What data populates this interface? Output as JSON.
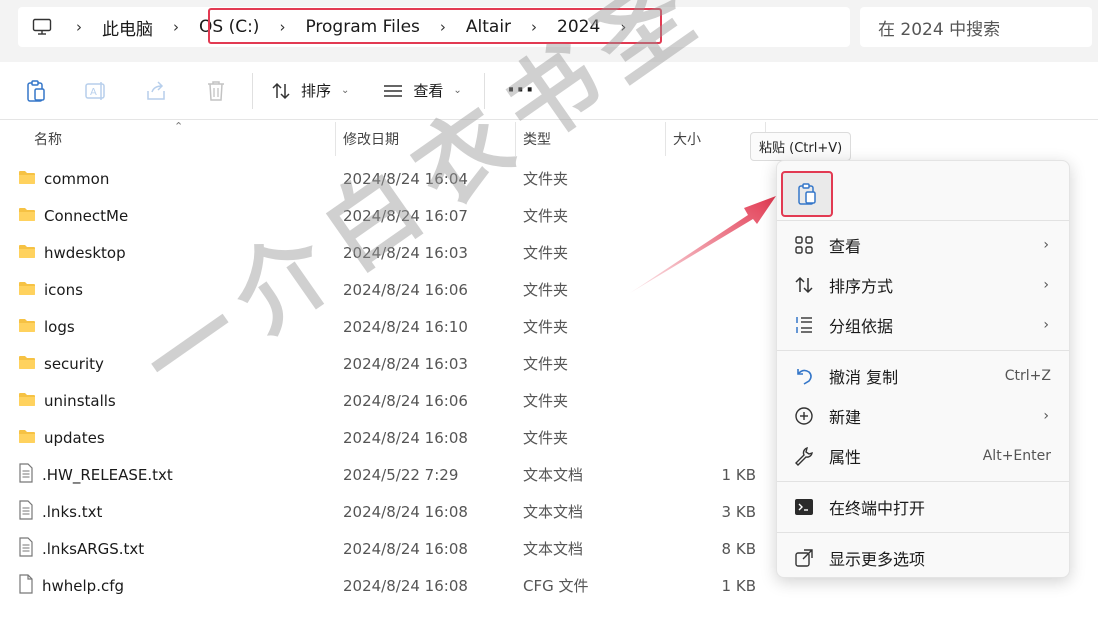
{
  "address_bar": {
    "crumbs": [
      "此电脑",
      "OS (C:)",
      "Program Files",
      "Altair",
      "2024"
    ],
    "search_placeholder": "在 2024 中搜索"
  },
  "toolbar": {
    "sort_label": "排序",
    "view_label": "查看",
    "more_label": "···"
  },
  "columns": {
    "name": "名称",
    "modified": "修改日期",
    "type": "类型",
    "size": "大小"
  },
  "files": [
    {
      "name": "common",
      "modified": "2024/8/24 16:04",
      "type": "文件夹",
      "size": "",
      "kind": "folder"
    },
    {
      "name": "ConnectMe",
      "modified": "2024/8/24 16:07",
      "type": "文件夹",
      "size": "",
      "kind": "folder"
    },
    {
      "name": "hwdesktop",
      "modified": "2024/8/24 16:03",
      "type": "文件夹",
      "size": "",
      "kind": "folder"
    },
    {
      "name": "icons",
      "modified": "2024/8/24 16:06",
      "type": "文件夹",
      "size": "",
      "kind": "folder"
    },
    {
      "name": "logs",
      "modified": "2024/8/24 16:10",
      "type": "文件夹",
      "size": "",
      "kind": "folder"
    },
    {
      "name": "security",
      "modified": "2024/8/24 16:03",
      "type": "文件夹",
      "size": "",
      "kind": "folder"
    },
    {
      "name": "uninstalls",
      "modified": "2024/8/24 16:06",
      "type": "文件夹",
      "size": "",
      "kind": "folder"
    },
    {
      "name": "updates",
      "modified": "2024/8/24 16:08",
      "type": "文件夹",
      "size": "",
      "kind": "folder"
    },
    {
      "name": ".HW_RELEASE.txt",
      "modified": "2024/5/22 7:29",
      "type": "文本文档",
      "size": "1 KB",
      "kind": "text"
    },
    {
      "name": ".lnks.txt",
      "modified": "2024/8/24 16:08",
      "type": "文本文档",
      "size": "3 KB",
      "kind": "text"
    },
    {
      "name": ".lnksARGS.txt",
      "modified": "2024/8/24 16:08",
      "type": "文本文档",
      "size": "8 KB",
      "kind": "text"
    },
    {
      "name": "hwhelp.cfg",
      "modified": "2024/8/24 16:08",
      "type": "CFG 文件",
      "size": "1 KB",
      "kind": "file"
    }
  ],
  "tooltip": "粘贴 (Ctrl+V)",
  "context_menu": {
    "view": "查看",
    "sort_by": "排序方式",
    "group_by": "分组依据",
    "undo_copy": "撤消 复制",
    "undo_shortcut": "Ctrl+Z",
    "new": "新建",
    "properties": "属性",
    "properties_shortcut": "Alt+Enter",
    "open_terminal": "在终端中打开",
    "show_more": "显示更多选项"
  },
  "watermark": "一介白衣书圣",
  "colors": {
    "highlight": "#e23a52",
    "folder": "#f6c244"
  }
}
